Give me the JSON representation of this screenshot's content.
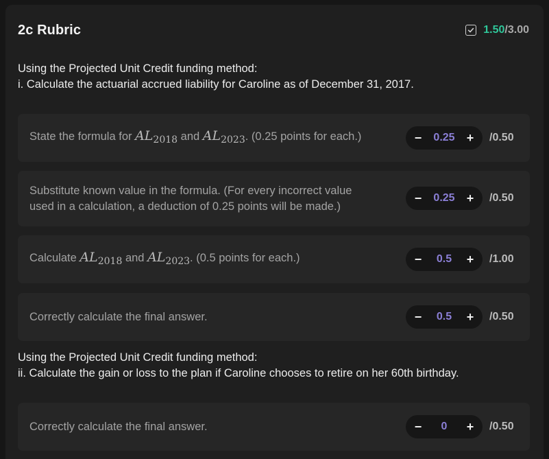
{
  "header": {
    "title": "2c Rubric",
    "score_earned": "1.50",
    "score_separator": "/",
    "score_total": "3.00"
  },
  "questions": [
    {
      "line1": "Using the Projected Unit Credit funding method:",
      "line2": "i. Calculate the actuarial accrued liability for Caroline as of December 31, 2017."
    },
    {
      "line1": "Using the Projected Unit Credit funding method:",
      "line2": "ii. Calculate the gain or loss to the plan if Caroline chooses to retire on her 60th birthday."
    }
  ],
  "criteria": [
    {
      "text_pre": "State the formula for ",
      "math1": "AL",
      "sub1": "2018",
      "text_mid": " and ",
      "math2": "AL",
      "sub2": "2023",
      "text_post": ". (0.25 points for each.)",
      "value": "0.25",
      "max": "/0.50"
    },
    {
      "line1": "Substitute known value in the formula. (For every incorrect value",
      "line2": "used in a calculation, a deduction of 0.25 points will be made.)",
      "value": "0.25",
      "max": "/0.50"
    },
    {
      "text_pre": "Calculate ",
      "math1": "AL",
      "sub1": "2018",
      "text_mid": " and ",
      "math2": "AL",
      "sub2": "2023",
      "text_post": ". (0.5 points for each.)",
      "value": "0.5",
      "max": "/1.00"
    },
    {
      "text": "Correctly calculate the final answer.",
      "value": "0.5",
      "max": "/0.50"
    },
    {
      "text": "Correctly calculate the final answer.",
      "value": "0",
      "max": "/0.50"
    }
  ],
  "controls": {
    "decrement": "−",
    "increment": "+"
  },
  "icons": {
    "score_icon": "checkbox-checked-icon"
  },
  "colors": {
    "earned": "#2fc79a",
    "value": "#8b7fd6"
  }
}
